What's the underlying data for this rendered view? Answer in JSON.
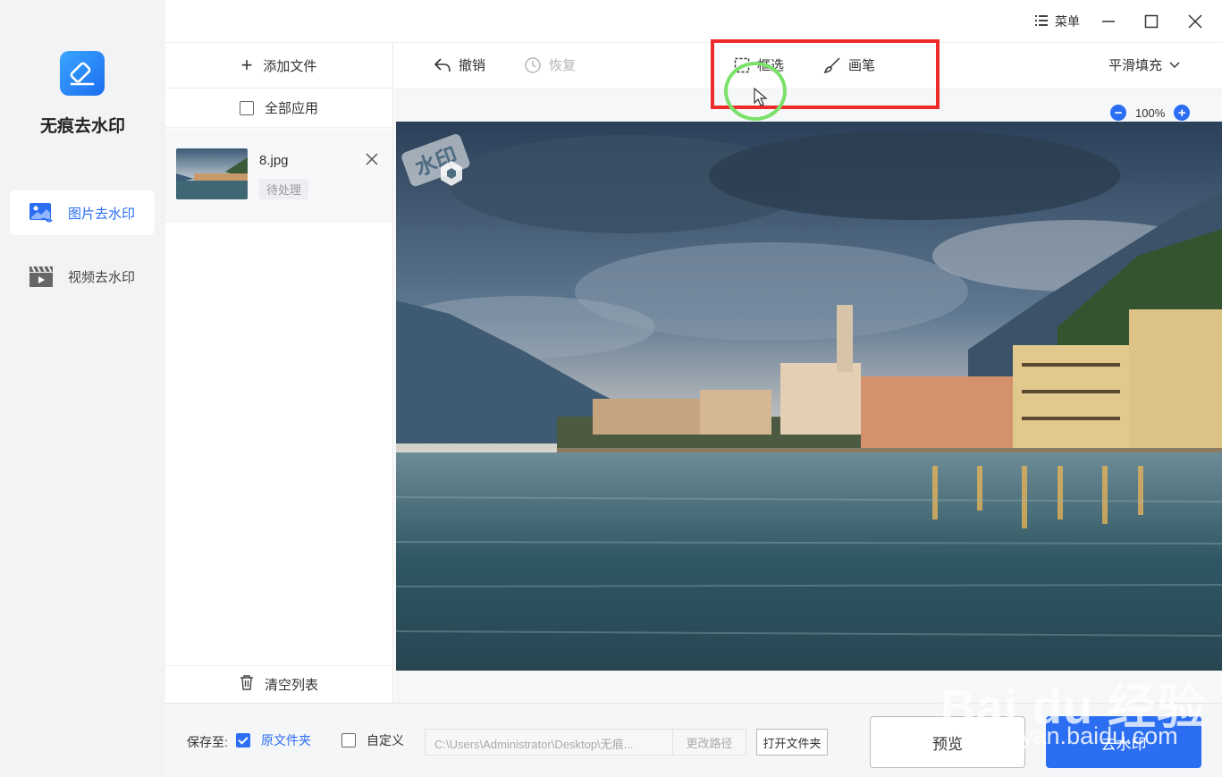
{
  "app": {
    "name": "无痕去水印"
  },
  "nav": {
    "items": [
      {
        "label": "图片去水印",
        "icon": "image-icon",
        "active": true
      },
      {
        "label": "视频去水印",
        "icon": "video-icon",
        "active": false
      }
    ]
  },
  "titlebar": {
    "menu_label": "菜单"
  },
  "files": {
    "add_label": "添加文件",
    "apply_all_label": "全部应用",
    "items": [
      {
        "name": "8.jpg",
        "status": "待处理"
      }
    ],
    "clear_label": "清空列表"
  },
  "toolbar": {
    "undo_label": "撤销",
    "redo_label": "恢复",
    "select_label": "框选",
    "brush_label": "画笔",
    "fill_mode_label": "平滑填充"
  },
  "canvas": {
    "zoom_level": "100%",
    "watermark_text": "水印"
  },
  "bottom": {
    "save_to_label": "保存至:",
    "original_folder_label": "原文件夹",
    "custom_label": "自定义",
    "path_value": "C:\\Users\\Administrator\\Desktop\\无痕...",
    "change_path_label": "更改路径",
    "open_folder_label": "打开文件夹",
    "preview_label": "预览",
    "remove_label": "去水印"
  },
  "overlay": {
    "brand_text": "Bai du 经验",
    "brand_url": "jingyan.baidu.com"
  },
  "colors": {
    "accent": "#2b6ef2",
    "highlight_box": "#ee2b2b",
    "cursor_ring": "#7be16a"
  }
}
